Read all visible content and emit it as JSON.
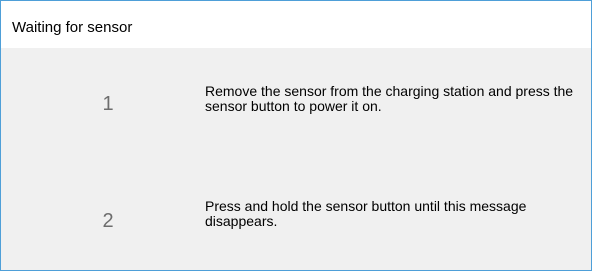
{
  "window": {
    "title": "Waiting for sensor"
  },
  "steps": [
    {
      "number": "1",
      "text": "Remove the sensor from the charging station and press the sensor button to power it on."
    },
    {
      "number": "2",
      "text": "Press and hold the sensor button until this message disappears."
    }
  ],
  "colors": {
    "window_border": "#4e9fd8",
    "titlebar_background": "#ffffff",
    "content_background": "#f0f0f0",
    "step_number": "#6d6d6d",
    "text": "#000000"
  }
}
